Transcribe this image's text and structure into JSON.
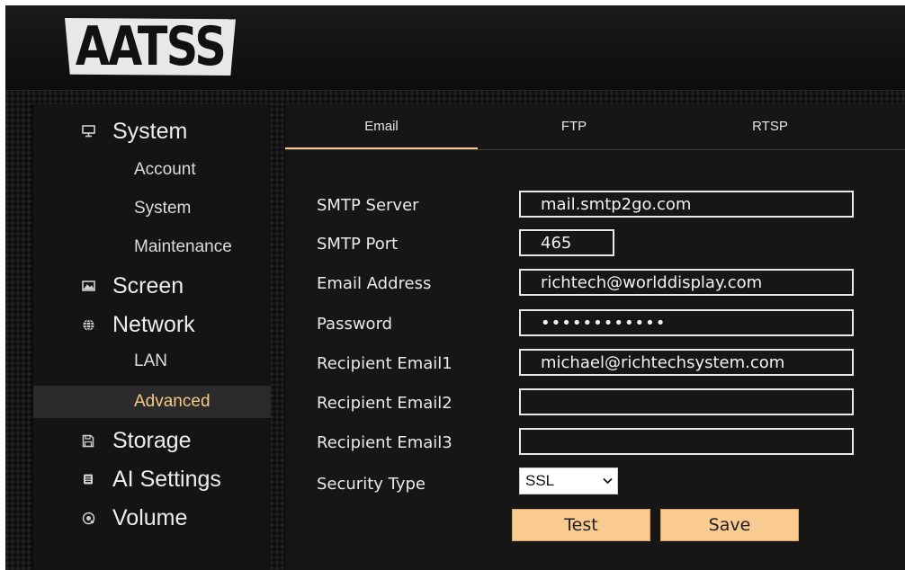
{
  "brand": {
    "logo_text": "AATSS"
  },
  "sidebar": {
    "items": [
      {
        "label": "System",
        "icon": "monitor-icon"
      },
      {
        "label": "Account"
      },
      {
        "label": "System"
      },
      {
        "label": "Maintenance"
      },
      {
        "label": "Screen",
        "icon": "image-icon"
      },
      {
        "label": "Network",
        "icon": "globe-icon"
      },
      {
        "label": "LAN"
      },
      {
        "label": "Advanced",
        "active": true
      },
      {
        "label": "Storage",
        "icon": "floppy-disk-icon"
      },
      {
        "label": "AI Settings",
        "icon": "chip-icon"
      },
      {
        "label": "Volume",
        "icon": "speaker-icon"
      }
    ]
  },
  "tabs": [
    {
      "label": "Email",
      "active": true
    },
    {
      "label": "FTP"
    },
    {
      "label": "RTSP"
    }
  ],
  "form": {
    "smtp_server": {
      "label": "SMTP Server",
      "value": "mail.smtp2go.com"
    },
    "smtp_port": {
      "label": "SMTP Port",
      "value": "465"
    },
    "email_address": {
      "label": "Email Address",
      "value": "richtech@worlddisplay.com"
    },
    "password": {
      "label": "Password",
      "value": "••••••••••••"
    },
    "recipient1": {
      "label": "Recipient Email1",
      "value": "michael@richtechsystem.com"
    },
    "recipient2": {
      "label": "Recipient Email2",
      "value": ""
    },
    "recipient3": {
      "label": "Recipient Email3",
      "value": ""
    },
    "security_type": {
      "label": "Security Type",
      "value": "SSL"
    }
  },
  "buttons": {
    "test": "Test",
    "save": "Save"
  },
  "colors": {
    "accent": "#f9cb91",
    "active_text": "#f7c883",
    "background": "#151515"
  }
}
